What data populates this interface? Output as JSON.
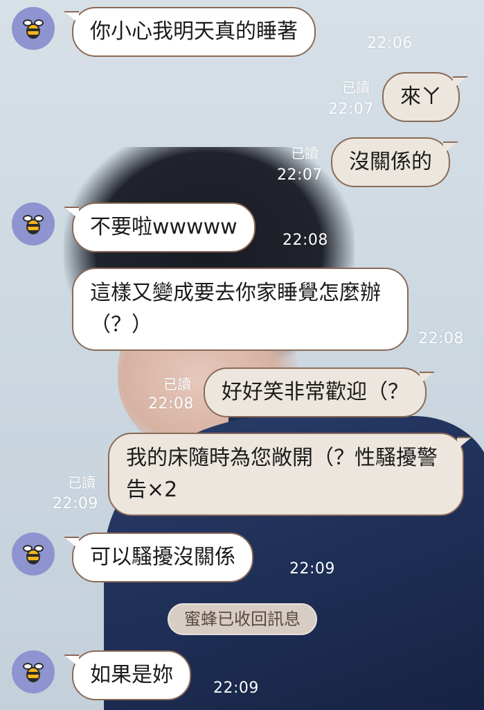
{
  "contact": {
    "avatar_icon": "bee-icon",
    "avatar_color": "#8e94cf"
  },
  "colors": {
    "incoming_bubble": "#ffffff",
    "outgoing_bubble": "#ece6de",
    "bubble_border": "#8a6a57"
  },
  "messages": [
    {
      "from": "them",
      "text": "你小心我明天真的睡著",
      "time": "22:06"
    },
    {
      "from": "me",
      "text": "來ㄚ",
      "time": "22:07",
      "read": "已讀"
    },
    {
      "from": "me",
      "text": "沒關係的",
      "time": "22:07",
      "read": "已讀"
    },
    {
      "from": "them",
      "text": "不要啦wwwww",
      "time": "22:08"
    },
    {
      "from": "them",
      "text": "這樣又變成要去你家睡覺怎麼辦（？）",
      "time": "22:08"
    },
    {
      "from": "me",
      "text": "好好笑非常歡迎（？",
      "time": "22:08",
      "read": "已讀"
    },
    {
      "from": "me",
      "text": "我的床隨時為您敞開（？性騷擾警告×2",
      "time": "22:09",
      "read": "已讀"
    },
    {
      "from": "them",
      "text": "可以騷擾沒關係",
      "time": "22:09"
    },
    {
      "from": "them",
      "text": "如果是妳",
      "time": "22:09"
    }
  ],
  "system_notice": "蜜蜂已收回訊息"
}
